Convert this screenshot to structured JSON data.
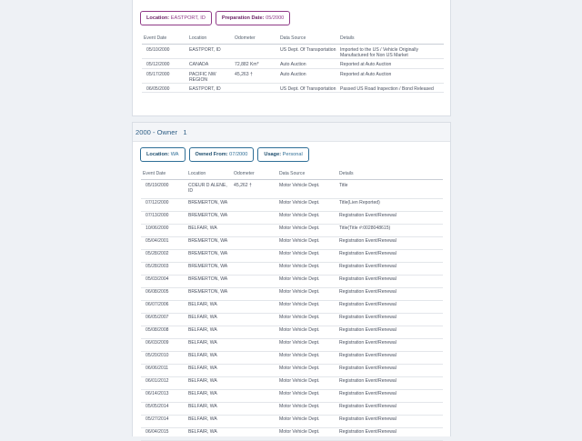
{
  "top_section": {
    "tags": [
      {
        "key": "Location:",
        "value": "EASTPORT, ID"
      },
      {
        "key": "Preparation Date:",
        "value": "05/2000"
      }
    ],
    "columns": [
      "Event Date",
      "Location",
      "Odometer",
      "Data Source",
      "Details"
    ],
    "rows": [
      [
        "05/10/2000",
        "EASTPORT, ID",
        "",
        "US Dept. Of Transportation",
        "Imported to the US / Vehicle Originally Manufactured for Non US Market"
      ],
      [
        "05/12/2000",
        "CANADA",
        "72,882 Km*",
        "Auto Auction",
        "Reported at Auto Auction"
      ],
      [
        "05/17/2000",
        "PACIFIC NW REGION",
        "45,263 †",
        "Auto Auction",
        "Reported at Auto Auction"
      ],
      [
        "06/05/2000",
        "EASTPORT, ID",
        "",
        "US Dept. Of Transportation",
        "Passed US Road Inspection / Bond Released"
      ]
    ]
  },
  "owner_section": {
    "title": "2000 - Owner   1",
    "tags": [
      {
        "key": "Location:",
        "value": "WA"
      },
      {
        "key": "Owned From:",
        "value": "07/2000"
      },
      {
        "key": "Usage:",
        "value": "Personal"
      }
    ],
    "columns": [
      "Event Date",
      "Location",
      "Odometer",
      "Data Source",
      "Details"
    ],
    "rows": [
      [
        "05/19/2000",
        "COEUR D ALENE, ID",
        "45,262 †",
        "Motor Vehicle Dept.",
        "Title"
      ],
      [
        "07/12/2000",
        "BREMERTON, WA",
        "",
        "Motor Vehicle Dept.",
        "Title(Lien Reported)"
      ],
      [
        "07/13/2000",
        "BREMERTON, WA",
        "",
        "Motor Vehicle Dept.",
        "Registration Event/Renewal"
      ],
      [
        "10/06/2000",
        "BELFAIR, WA",
        "",
        "Motor Vehicle Dept.",
        "Title(Title #:0028048615)"
      ],
      [
        "05/04/2001",
        "BREMERTON, WA",
        "",
        "Motor Vehicle Dept.",
        "Registration Event/Renewal"
      ],
      [
        "05/28/2002",
        "BREMERTON, WA",
        "",
        "Motor Vehicle Dept.",
        "Registration Event/Renewal"
      ],
      [
        "05/28/2003",
        "BREMERTON, WA",
        "",
        "Motor Vehicle Dept.",
        "Registration Event/Renewal"
      ],
      [
        "05/03/2004",
        "BREMERTON, WA",
        "",
        "Motor Vehicle Dept.",
        "Registration Event/Renewal"
      ],
      [
        "06/08/2005",
        "BREMERTON, WA",
        "",
        "Motor Vehicle Dept.",
        "Registration Event/Renewal"
      ],
      [
        "06/07/2006",
        "BELFAIR, WA",
        "",
        "Motor Vehicle Dept.",
        "Registration Event/Renewal"
      ],
      [
        "06/05/2007",
        "BELFAIR, WA",
        "",
        "Motor Vehicle Dept.",
        "Registration Event/Renewal"
      ],
      [
        "05/08/2008",
        "BELFAIR, WA",
        "",
        "Motor Vehicle Dept.",
        "Registration Event/Renewal"
      ],
      [
        "06/03/2009",
        "BELFAIR, WA",
        "",
        "Motor Vehicle Dept.",
        "Registration Event/Renewal"
      ],
      [
        "05/20/2010",
        "BELFAIR, WA",
        "",
        "Motor Vehicle Dept.",
        "Registration Event/Renewal"
      ],
      [
        "06/06/2011",
        "BELFAIR, WA",
        "",
        "Motor Vehicle Dept.",
        "Registration Event/Renewal"
      ],
      [
        "06/01/2012",
        "BELFAIR, WA",
        "",
        "Motor Vehicle Dept.",
        "Registration Event/Renewal"
      ],
      [
        "06/14/2013",
        "BELFAIR, WA",
        "",
        "Motor Vehicle Dept.",
        "Registration Event/Renewal"
      ],
      [
        "05/05/2014",
        "BELFAIR, WA",
        "",
        "Motor Vehicle Dept.",
        "Registration Event/Renewal"
      ],
      [
        "05/27/2014",
        "BELFAIR, WA",
        "",
        "Motor Vehicle Dept.",
        "Registration Event/Renewal"
      ],
      [
        "06/04/2015",
        "BELFAIR, WA",
        "",
        "Motor Vehicle Dept.",
        "Registration Event/Renewal"
      ]
    ]
  },
  "colors": {
    "prep_tag_accent": "#8f3a87",
    "owner_tag_accent": "#2f6f97",
    "owner_title": "#2f5f86",
    "page_background": "#eef1f5"
  }
}
